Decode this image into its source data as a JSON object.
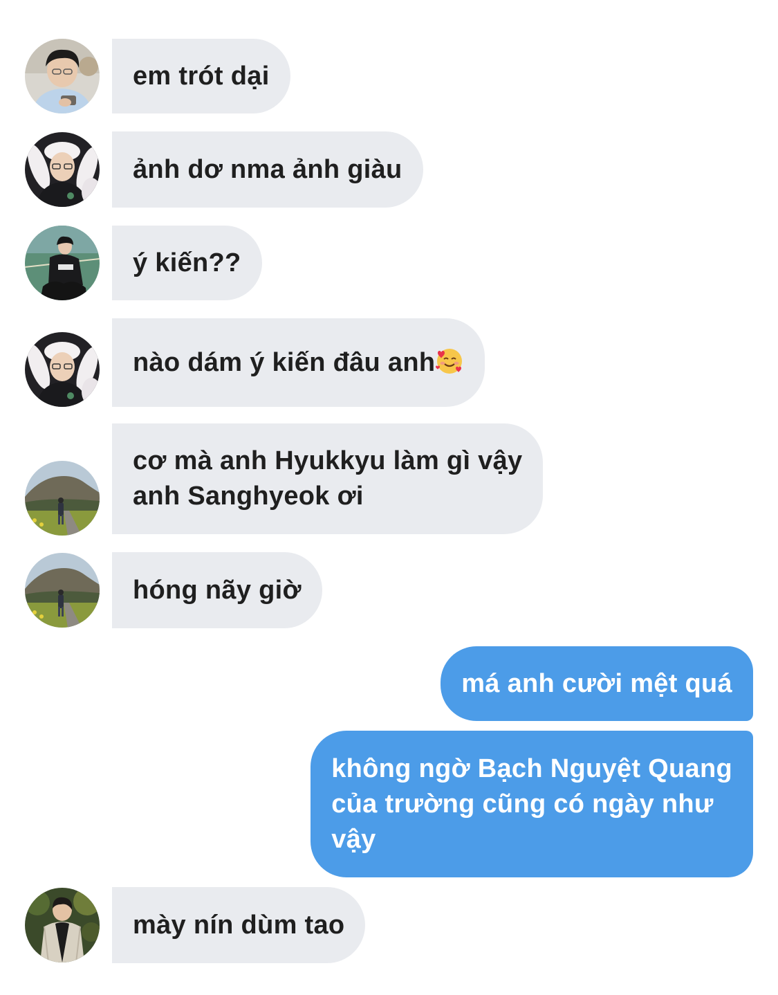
{
  "messages": [
    {
      "side": "incoming",
      "avatar": "avatar-boy-phone",
      "text": "em trót dại"
    },
    {
      "side": "incoming",
      "avatar": "avatar-boy-bunny-hat",
      "text": "ảnh dơ nma ảnh giàu"
    },
    {
      "side": "incoming",
      "avatar": "avatar-boy-court",
      "text": "ý kiến??"
    },
    {
      "side": "incoming",
      "avatar": "avatar-boy-bunny-hat",
      "text": "nào dám ý kiến đâu anh",
      "emoji": "smiling-face-with-hearts-icon"
    },
    {
      "side": "incoming",
      "avatar": "avatar-mountain-walker",
      "text": "cơ mà anh Hyukkyu làm gì vậy\nanh Sanghyeok ơi"
    },
    {
      "side": "incoming",
      "avatar": "avatar-mountain-walker",
      "text": "hóng nãy giờ"
    },
    {
      "side": "outgoing",
      "text": "má anh cười mệt quá"
    },
    {
      "side": "outgoing",
      "text": "không ngờ Bạch Nguyệt Quang\ncủa trường cũng có ngày như\nvậy"
    },
    {
      "side": "incoming",
      "avatar": "avatar-boy-jacket",
      "text": "mày nín dùm tao"
    }
  ],
  "colors": {
    "incoming_bubble": "#e9ebef",
    "incoming_text": "#1f1f1f",
    "outgoing_bubble": "#4c9ce8",
    "outgoing_text": "#ffffff",
    "background": "#ffffff"
  }
}
